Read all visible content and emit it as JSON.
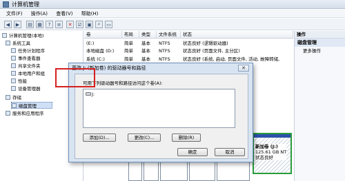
{
  "window": {
    "title": "计算机管理"
  },
  "menu": [
    "文件(F)",
    "操作(A)",
    "查看(V)",
    "帮助(H)"
  ],
  "toolbar_icons": [
    "back-arrow-icon",
    "forward-arrow-icon",
    "folder-icon",
    "properties-icon",
    "help-icon",
    "list-view-icon",
    "delete-icon",
    "checklist-icon",
    "open-folder-icon",
    "search-icon",
    "drive-icon"
  ],
  "tree": [
    {
      "label": "计算机管理(本地)",
      "indent": 0
    },
    {
      "label": "系统工具",
      "indent": 1
    },
    {
      "label": "任务计划程序",
      "indent": 2
    },
    {
      "label": "事件查看器",
      "indent": 2
    },
    {
      "label": "共享文件夹",
      "indent": 2
    },
    {
      "label": "本地用户和组",
      "indent": 2
    },
    {
      "label": "性能",
      "indent": 2
    },
    {
      "label": "设备管理器",
      "indent": 2
    },
    {
      "label": "存储",
      "indent": 1
    },
    {
      "label": "磁盘管理",
      "indent": 2
    },
    {
      "label": "服务和应用程序",
      "indent": 1
    }
  ],
  "volume_list": {
    "headers": [
      "卷",
      "布局",
      "类型",
      "文件系统",
      "状态"
    ],
    "rows": [
      [
        "(E:)",
        "简单",
        "基本",
        "NTFS",
        "状态良好 (逻辑驱动器)"
      ],
      [
        "本地磁盘 (D:)",
        "简单",
        "基本",
        "NTFS",
        "状态良好 (页面文件, 主分区)"
      ],
      [
        "",
        "",
        "",
        "",
        ""
      ],
      [
        "系统 (C:)",
        "简单",
        "基本",
        "NTFS",
        "状态良好 (系统, 启动, 页面文件, 活动, 故障转储,"
      ]
    ]
  },
  "actions": {
    "header": "操作",
    "section": "磁盘管理",
    "more": "更多操作"
  },
  "dialog": {
    "title": "更改 J: (新加卷) 的驱动器号和路径",
    "close": "✕",
    "description": "可用下列驱动器号和路径访问这个卷(A):",
    "list_items": [
      "J:"
    ],
    "buttons": {
      "add": "添加(D)...",
      "change": "更改(C)...",
      "remove": "删除(R)",
      "ok": "确定",
      "cancel": "取消"
    }
  },
  "new_volume": {
    "name": "新加卷 (J:)",
    "size": "125.61 GB NT",
    "status": "状态良好"
  },
  "highlight_color": "#d61f1f"
}
